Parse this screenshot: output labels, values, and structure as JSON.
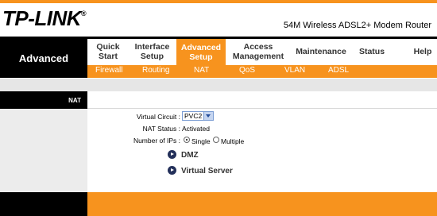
{
  "brand": {
    "logo": "TP-LINK",
    "registered": "®",
    "product": "54M Wireless ADSL2+ Modem Router"
  },
  "section_title": "Advanced",
  "nav": [
    {
      "label": "Quick Start"
    },
    {
      "label": "Interface Setup"
    },
    {
      "label": "Advanced Setup"
    },
    {
      "label": "Access Management"
    },
    {
      "label": "Maintenance"
    },
    {
      "label": "Status"
    },
    {
      "label": "Help"
    }
  ],
  "subnav": [
    "Firewall",
    "Routing",
    "NAT",
    "QoS",
    "VLAN",
    "ADSL"
  ],
  "panel_title": "NAT",
  "form": {
    "virtual_circuit_label": "Virtual Circuit :",
    "virtual_circuit_value": "PVC2",
    "nat_status_label": "NAT Status :",
    "nat_status_value": "Activated",
    "num_ips_label": "Number of IPs :",
    "option_single": "Single",
    "option_multiple": "Multiple",
    "selected_option": "Single"
  },
  "links": {
    "dmz": "DMZ",
    "virtual_server": "Virtual Server"
  },
  "colors": {
    "accent": "#f7931e",
    "dark": "#000000"
  }
}
